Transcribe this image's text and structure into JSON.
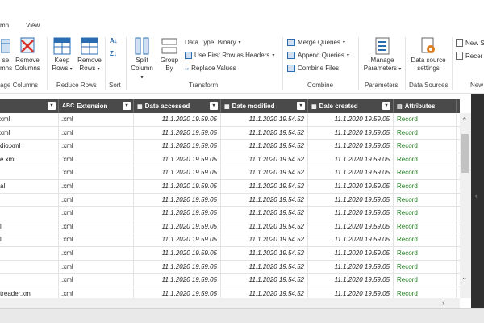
{
  "tabs": [
    "mn",
    "View"
  ],
  "ribbon": {
    "groups": {
      "manage_columns": "age Columns",
      "reduce_rows": "Reduce Rows",
      "sort": "Sort",
      "transform": "Transform",
      "combine": "Combine",
      "parameters": "Parameters",
      "data_sources": "Data Sources",
      "new": "New"
    },
    "choose_columns": [
      "se",
      "mns"
    ],
    "remove_columns": [
      "Remove",
      "Columns"
    ],
    "keep_rows": [
      "Keep",
      "Rows"
    ],
    "remove_rows": [
      "Remove",
      "Rows"
    ],
    "split_column": [
      "Split",
      "Column"
    ],
    "group_by": [
      "Group",
      "By"
    ],
    "data_type": "Data Type: Binary",
    "use_first_row": "Use First Row as Headers",
    "replace_values": "Replace Values",
    "merge_queries": "Merge Queries",
    "append_queries": "Append Queries",
    "combine_files": "Combine Files",
    "manage_parameters": [
      "Manage",
      "Parameters"
    ],
    "data_source_settings": [
      "Data source",
      "settings"
    ],
    "new_source": "New S",
    "recent_sources": "Recer",
    "sort_asc": "A↓",
    "sort_desc": "Z↓"
  },
  "table": {
    "columns": [
      {
        "label": "",
        "type": ""
      },
      {
        "label": "Extension",
        "type": "ABC"
      },
      {
        "label": "Date accessed",
        "type": "▦"
      },
      {
        "label": "Date modified",
        "type": "▦"
      },
      {
        "label": "Date created",
        "type": "▦"
      },
      {
        "label": "Attributes",
        "type": "▤"
      },
      {
        "label": "",
        "type": "⇆"
      }
    ],
    "rows": [
      {
        "name": "xml",
        "ext": ".xml",
        "accessed": "11.1.2020 19.59.05",
        "modified": "11.1.2020 19.54.52",
        "created": "11.1.2020 19.59.05",
        "attr": "Record"
      },
      {
        "name": "xml",
        "ext": ".xml",
        "accessed": "11.1.2020 19.59.05",
        "modified": "11.1.2020 19.54.52",
        "created": "11.1.2020 19.59.05",
        "attr": "Record"
      },
      {
        "name": "dio.xml",
        "ext": ".xml",
        "accessed": "11.1.2020 19.59.05",
        "modified": "11.1.2020 19.54.52",
        "created": "11.1.2020 19.59.05",
        "attr": "Record"
      },
      {
        "name": "e.xml",
        "ext": ".xml",
        "accessed": "11.1.2020 19.59.05",
        "modified": "11.1.2020 19.54.52",
        "created": "11.1.2020 19.59.05",
        "attr": "Record"
      },
      {
        "name": "",
        "ext": ".xml",
        "accessed": "11.1.2020 19.59.05",
        "modified": "11.1.2020 19.54.52",
        "created": "11.1.2020 19.59.05",
        "attr": "Record"
      },
      {
        "name": "al",
        "ext": ".xml",
        "accessed": "11.1.2020 19.59.05",
        "modified": "11.1.2020 19.54.52",
        "created": "11.1.2020 19.59.05",
        "attr": "Record"
      },
      {
        "name": "",
        "ext": ".xml",
        "accessed": "11.1.2020 19.59.05",
        "modified": "11.1.2020 19.54.52",
        "created": "11.1.2020 19.59.05",
        "attr": "Record"
      },
      {
        "name": "",
        "ext": ".xml",
        "accessed": "11.1.2020 19.59.05",
        "modified": "11.1.2020 19.54.52",
        "created": "11.1.2020 19.59.05",
        "attr": "Record"
      },
      {
        "name": "l",
        "ext": ".xml",
        "accessed": "11.1.2020 19.59.05",
        "modified": "11.1.2020 19.54.52",
        "created": "11.1.2020 19.59.05",
        "attr": "Record"
      },
      {
        "name": "l",
        "ext": ".xml",
        "accessed": "11.1.2020 19.59.05",
        "modified": "11.1.2020 19.54.52",
        "created": "11.1.2020 19.59.05",
        "attr": "Record"
      },
      {
        "name": "",
        "ext": ".xml",
        "accessed": "11.1.2020 19.59.05",
        "modified": "11.1.2020 19.54.52",
        "created": "11.1.2020 19.59.05",
        "attr": "Record"
      },
      {
        "name": "",
        "ext": ".xml",
        "accessed": "11.1.2020 19.59.05",
        "modified": "11.1.2020 19.54.52",
        "created": "11.1.2020 19.59.05",
        "attr": "Record"
      },
      {
        "name": "",
        "ext": ".xml",
        "accessed": "11.1.2020 19.59.05",
        "modified": "11.1.2020 19.54.52",
        "created": "11.1.2020 19.59.05",
        "attr": "Record"
      },
      {
        "name": "treader.xml",
        "ext": ".xml",
        "accessed": "11.1.2020 19.59.05",
        "modified": "11.1.2020 19.54.52",
        "created": "11.1.2020 19.59.05",
        "attr": "Record"
      }
    ]
  },
  "colors": {
    "header_bg": "#4a4a4a",
    "record_green": "#1e7d1e",
    "icon_blue": "#2b6cb0",
    "icon_red": "#d9342b",
    "icon_orange": "#e07b1a"
  }
}
